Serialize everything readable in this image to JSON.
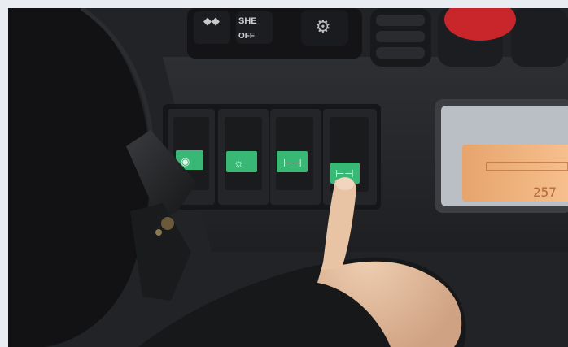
{
  "scene": {
    "top_control_labels": [
      "SHE",
      "OFF"
    ],
    "display_reading": "257",
    "switches": [
      {
        "icon": "parking-light-icon",
        "indicator_color": "#39b774"
      },
      {
        "icon": "headlight-icon",
        "indicator_color": "#39b774"
      },
      {
        "icon": "work-light-icon",
        "indicator_color": "#39b774"
      },
      {
        "icon": "rear-work-light-icon",
        "indicator_color": "#39b774"
      }
    ],
    "colors": {
      "dashboard": "#2a2c2f",
      "switch_indicator": "#39b774",
      "display_backlight": "#f2a96a",
      "red_button": "#c8262b"
    }
  }
}
